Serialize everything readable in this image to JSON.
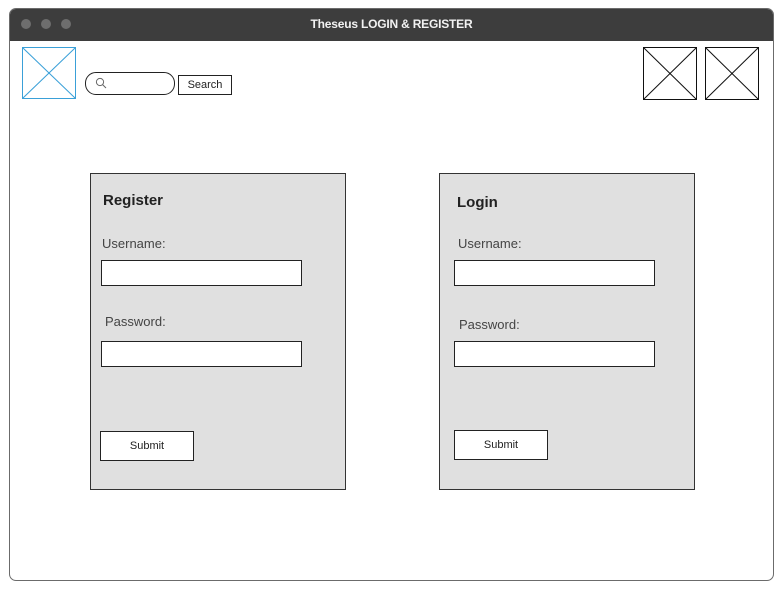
{
  "window": {
    "title": "Theseus LOGIN & REGISTER"
  },
  "header": {
    "search": {
      "placeholder": "",
      "button_label": "Search"
    }
  },
  "register": {
    "heading": "Register",
    "username_label": "Username:",
    "password_label": "Password:",
    "submit_label": "Submit"
  },
  "login": {
    "heading": "Login",
    "username_label": "Username:",
    "password_label": "Password:",
    "submit_label": "Submit"
  },
  "colors": {
    "titlebar": "#3d3d3d",
    "panel": "#e0e0e0",
    "logo_outline": "#3aa0d8"
  }
}
